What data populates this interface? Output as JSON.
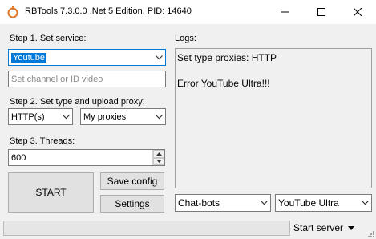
{
  "window": {
    "title": "RBTools 7.3.0.0 .Net 5 Edition. PID: 14640",
    "minimize_icon": "minimize-icon",
    "maximize_icon": "maximize-icon",
    "close_icon": "close-icon"
  },
  "step1": {
    "label": "Step 1. Set service:",
    "service_selected": "Youtube",
    "channel_placeholder": "Set channel or ID video"
  },
  "step2": {
    "label": "Step 2. Set type and upload proxy:",
    "proxy_type": "HTTP(s)",
    "proxy_source": "My proxies"
  },
  "step3": {
    "label": "Step 3. Threads:",
    "threads": "600"
  },
  "buttons": {
    "start": "START",
    "save_config": "Save config",
    "settings": "Settings"
  },
  "logs": {
    "label": "Logs:",
    "lines": [
      "Set type proxies: HTTP",
      "",
      "Error YouTube Ultra!!!"
    ]
  },
  "bottom_selects": {
    "mode": "Chat-bots",
    "variant": "YouTube Ultra"
  },
  "statusbar": {
    "start_server": "Start server"
  },
  "colors": {
    "selection": "#0078d7",
    "client_bg": "#f0f0f0",
    "button_bg": "#e1e1e1"
  }
}
